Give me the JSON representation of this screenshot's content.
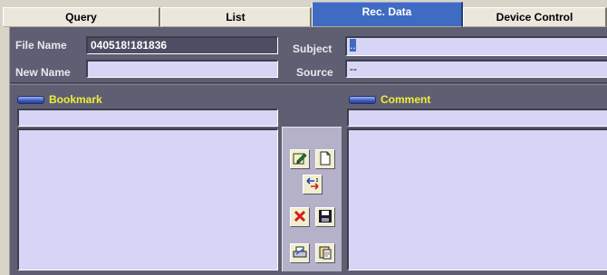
{
  "tabs": [
    {
      "label": "Query"
    },
    {
      "label": "List"
    },
    {
      "label": "Rec. Data"
    },
    {
      "label": "Device Control"
    }
  ],
  "form": {
    "file_name_label": "File Name",
    "file_name_value": "040518!181836",
    "new_name_label": "New Name",
    "new_name_value": "",
    "subject_label": "Subject",
    "subject_value": "..",
    "source_label": "Source",
    "source_value": "--"
  },
  "bookmark": {
    "title": "Bookmark",
    "input_value": "",
    "list_value": ""
  },
  "comment": {
    "title": "Comment",
    "input_value": "",
    "text_value": ""
  },
  "toolbar": {
    "icons": [
      "edit-icon",
      "new-page-icon",
      "move-icon",
      "delete-icon",
      "save-icon",
      "print-icon",
      "paste-icon"
    ]
  },
  "colors": {
    "panel": "#5f5f73",
    "field": "#d7d5f5",
    "accent_tab": "#3f6bc2",
    "section_title": "#f2ec3a"
  }
}
